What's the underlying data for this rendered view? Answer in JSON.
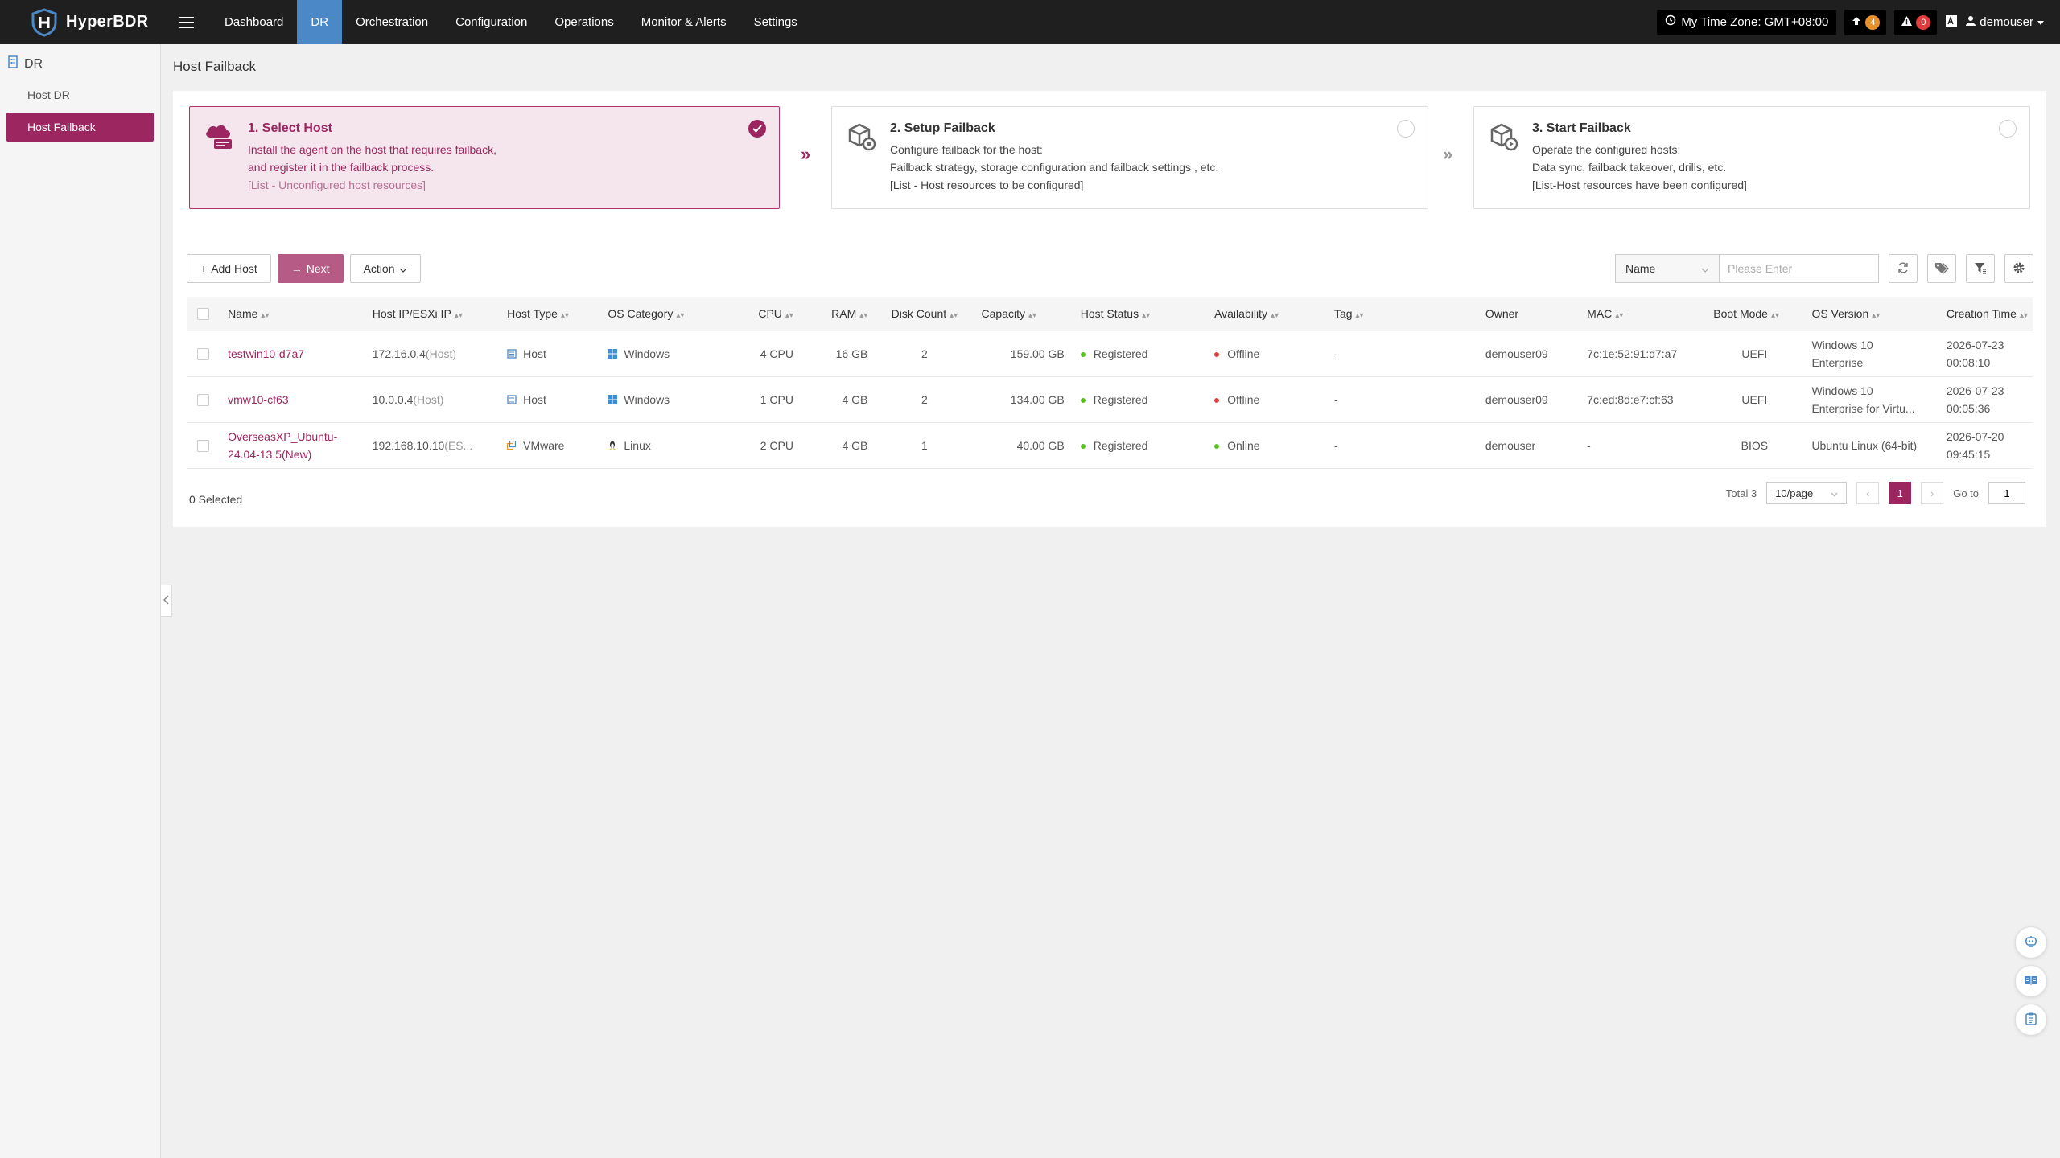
{
  "app": {
    "name": "HyperBDR"
  },
  "nav": {
    "items": [
      "Dashboard",
      "DR",
      "Orchestration",
      "Configuration",
      "Operations",
      "Monitor & Alerts",
      "Settings"
    ],
    "active": "DR"
  },
  "topbar": {
    "timezone": "My Time Zone: GMT+08:00",
    "upload_count": "4",
    "alert_count": "0",
    "user": "demouser"
  },
  "sidebar": {
    "group": "DR",
    "items": [
      "Host DR",
      "Host Failback"
    ],
    "active": "Host Failback"
  },
  "page": {
    "title": "Host Failback"
  },
  "steps": [
    {
      "title": "1. Select Host",
      "lines": [
        "Install the agent on the host that requires failback,",
        "and register it in the failback process."
      ],
      "note": "[List - Unconfigured host resources]",
      "status": "done"
    },
    {
      "title": "2. Setup Failback",
      "lines": [
        "Configure failback for the host:",
        "Failback strategy, storage configuration and failback settings , etc."
      ],
      "note": "[List - Host resources to be configured]",
      "status": "todo"
    },
    {
      "title": "3. Start Failback",
      "lines": [
        "Operate the configured hosts:",
        "Data sync, failback takeover, drills, etc."
      ],
      "note": "[List-Host resources have been configured]",
      "status": "todo"
    }
  ],
  "toolbar": {
    "add_host": "Add Host",
    "next": "Next",
    "action": "Action",
    "search_field": "Name",
    "search_placeholder": "Please Enter"
  },
  "table": {
    "columns": [
      "Name",
      "Host IP/ESXi IP",
      "Host Type",
      "OS Category",
      "CPU",
      "RAM",
      "Disk Count",
      "Capacity",
      "Host Status",
      "Availability",
      "Tag",
      "Owner",
      "MAC",
      "Boot Mode",
      "OS Version",
      "Creation Time"
    ],
    "rows": [
      {
        "name": "testwin10-d7a7",
        "ip": "172.16.0.4",
        "ip_suffix": "(Host)",
        "host_type": "Host",
        "os_category": "Windows",
        "cpu": "4 CPU",
        "ram": "16 GB",
        "disk_count": "2",
        "capacity": "159.00 GB",
        "host_status": "Registered",
        "availability": "Offline",
        "tag": "-",
        "owner": "demouser09",
        "mac": "7c:1e:52:91:d7:a7",
        "boot_mode": "UEFI",
        "os_version_1": "Windows 10",
        "os_version_2": "Enterprise",
        "created_date": "2026-07-23",
        "created_time": "00:08:10"
      },
      {
        "name": "vmw10-cf63",
        "ip": "10.0.0.4",
        "ip_suffix": "(Host)",
        "host_type": "Host",
        "os_category": "Windows",
        "cpu": "1 CPU",
        "ram": "4 GB",
        "disk_count": "2",
        "capacity": "134.00 GB",
        "host_status": "Registered",
        "availability": "Offline",
        "tag": "-",
        "owner": "demouser09",
        "mac": "7c:ed:8d:e7:cf:63",
        "boot_mode": "UEFI",
        "os_version_1": "Windows 10",
        "os_version_2": "Enterprise for Virtu...",
        "created_date": "2026-07-23",
        "created_time": "00:05:36"
      },
      {
        "name_1": "OverseasXP_Ubuntu-",
        "name_2": "24.04-13.5(New)",
        "ip": "192.168.10.10",
        "ip_suffix": "(ES...",
        "host_type": "VMware",
        "os_category": "Linux",
        "cpu": "2 CPU",
        "ram": "4 GB",
        "disk_count": "1",
        "capacity": "40.00 GB",
        "host_status": "Registered",
        "availability": "Online",
        "tag": "-",
        "owner": "demouser",
        "mac": "-",
        "boot_mode": "BIOS",
        "os_version_1": "Ubuntu Linux (64-bit)",
        "created_date": "2026-07-20",
        "created_time": "09:45:15"
      }
    ]
  },
  "footer": {
    "selected": "0 Selected",
    "total": "Total 3",
    "page_size": "10/page",
    "current_page": "1",
    "goto_label": "Go to",
    "goto_value": "1"
  },
  "colors": {
    "brand": "#9c2660",
    "nav_active": "#4a88c7",
    "status_green": "#52c41a",
    "status_red": "#e03c3c"
  },
  "icons": {
    "floating": [
      "robot-icon",
      "book-icon",
      "clipboard-icon"
    ]
  }
}
